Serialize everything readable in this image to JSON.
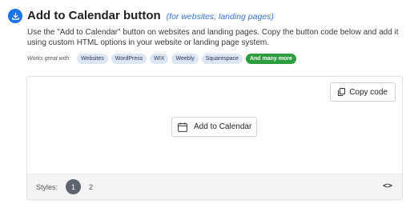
{
  "header": {
    "icon": "download-calendar-icon",
    "title": "Add to Calendar button",
    "subtitle": "(for websites, landing pages)"
  },
  "description": "Use the \"Add to Calendar\" button on websites and landing pages. Copy the button code below and add it using custom HTML options in your website or landing page system.",
  "works_with": {
    "label": "Works great with:",
    "tags": [
      "Websites",
      "WordPress",
      "WIX",
      "Weebly",
      "Squarespace"
    ],
    "more_label": "And many more"
  },
  "preview": {
    "copy_button": {
      "icon": "copy-icon",
      "label": "Copy code"
    },
    "add_button": {
      "icon": "calendar-icon",
      "label": "Add to Calendar"
    }
  },
  "styles": {
    "label": "Styles:",
    "options": [
      "1",
      "2"
    ],
    "selected": "1",
    "code_toggle": "<>"
  },
  "colors": {
    "accent": "#1a73e8",
    "link": "#3474d4",
    "more_badge": "#2e9d3f",
    "selected_style": "#5f6370"
  }
}
